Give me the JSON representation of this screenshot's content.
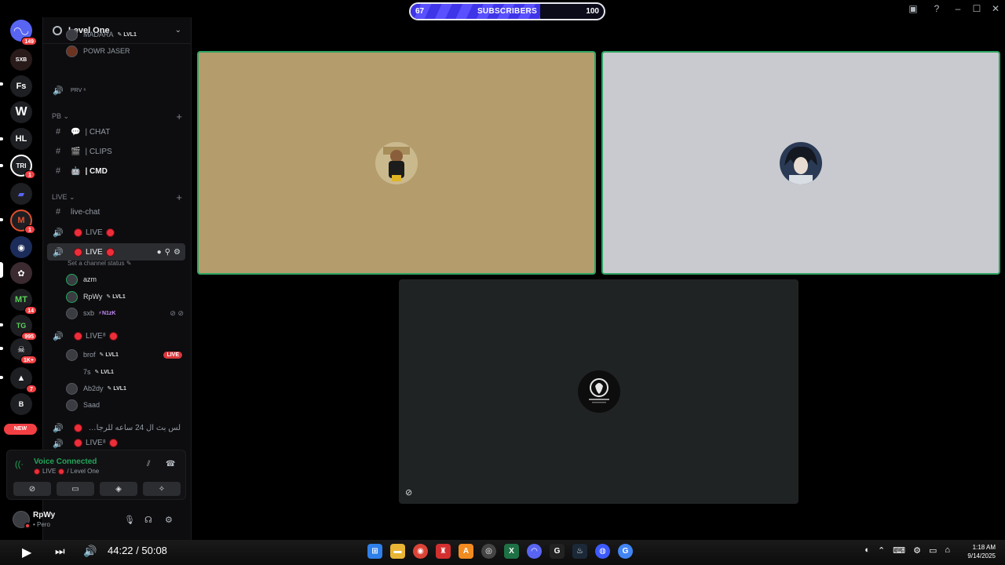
{
  "subscriber_bar": {
    "current": "67",
    "label": "SUBSCRIBERS",
    "goal": "100",
    "progress_fraction": 0.67
  },
  "window_controls": {
    "minimize": "–",
    "maximize": "☐",
    "close": "✕"
  },
  "rail": {
    "servers": [
      {
        "id": "home",
        "text": "◠◡",
        "badge": "149"
      },
      {
        "id": "s1",
        "text": "SXB",
        "badge": ""
      },
      {
        "id": "s2",
        "text": "Fs",
        "badge": ""
      },
      {
        "id": "s3",
        "text": "W",
        "badge": ""
      },
      {
        "id": "s4",
        "text": "HL",
        "badge": ""
      },
      {
        "id": "s5",
        "text": "TRI",
        "badge": "1"
      },
      {
        "id": "s6",
        "text": "▰",
        "badge": ""
      },
      {
        "id": "s7",
        "text": "M",
        "badge": "1"
      },
      {
        "id": "s8",
        "text": "◉",
        "badge": ""
      },
      {
        "id": "s9",
        "text": "✿",
        "badge": ""
      },
      {
        "id": "s10",
        "text": "MT",
        "badge": "14"
      },
      {
        "id": "s11",
        "text": "TG",
        "badge": "995"
      },
      {
        "id": "s12",
        "text": "☠",
        "badge": "1K+"
      },
      {
        "id": "s13",
        "text": "▲",
        "badge": "7"
      },
      {
        "id": "s14",
        "text": "B",
        "badge": ""
      }
    ],
    "new_badge": "NEW"
  },
  "guild": {
    "name": "Level One",
    "chevron": "⌄"
  },
  "channels": {
    "top_users": [
      {
        "name": "MADARA",
        "tag": "LVL1"
      },
      {
        "name": "POWR JASER",
        "tag": ""
      }
    ],
    "prv_channel": "PRV ⁸",
    "cat_pb": "PB ⌄",
    "pb_items": [
      {
        "name": "| CHAT",
        "emoji": "💬"
      },
      {
        "name": "| CLIPS",
        "emoji": "🎬"
      },
      {
        "name": "| CMD",
        "emoji": "🤖"
      }
    ],
    "cat_live": "LIVE ⌄",
    "live_chat": "live-chat",
    "live1": "LIVE",
    "live2": "LIVE",
    "live2_status": "Set a channel status ✎",
    "live2_users": [
      {
        "name": "azm",
        "tag": ""
      },
      {
        "name": "RpWy",
        "tag": "LVL1"
      },
      {
        "name": "sxb",
        "tag": "N1zK"
      }
    ],
    "live3": "LIVE⁸",
    "live3_users": [
      {
        "name": "brof",
        "tag": "LVL1",
        "live": "LIVE"
      },
      {
        "name": "7s",
        "tag": "LVL1"
      },
      {
        "name": "Ab2dy",
        "tag": "LVL1"
      },
      {
        "name": "Saad",
        "tag": ""
      }
    ],
    "arabic_channel": "لس بث ال 24 ساعه للرجال فقط...",
    "live4": "LIVE⁸"
  },
  "voice": {
    "title": "Voice Connected",
    "channel": "LIVE",
    "guild": "/ Level One"
  },
  "user_panel": {
    "name": "RpWy",
    "status": "• Pero"
  },
  "media": {
    "time": "44:22 / 50:08"
  },
  "clock": {
    "time": "1:18 AM",
    "date": "9/14/2025"
  },
  "colors": {
    "speaking_border": "#2fa462",
    "tile1": "#b49c6c",
    "tile2": "#c9cacf",
    "tile3": "#202324",
    "live_red": "#ed2e3a"
  }
}
